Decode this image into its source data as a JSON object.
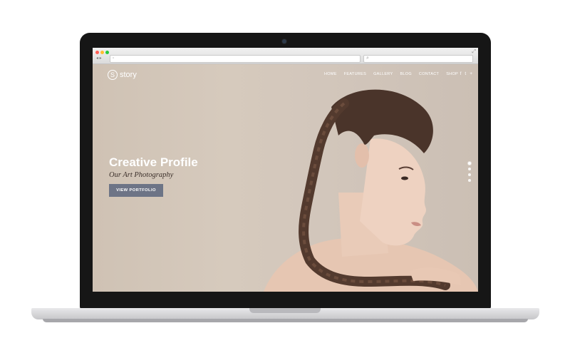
{
  "site": {
    "logo_mark": "S",
    "logo_text": "story",
    "nav": [
      "HOME",
      "FEATURES",
      "GALLERY",
      "BLOG",
      "CONTACT",
      "SHOP"
    ],
    "social_icons": [
      "f",
      "t",
      "+"
    ]
  },
  "hero": {
    "title": "Creative Profile",
    "subtitle": "Our Art Photography",
    "cta_label": "VIEW PORTFOLIO"
  },
  "browser": {
    "back_forward": "◂ ▸"
  },
  "icons": {
    "social": [
      "facebook-icon",
      "twitter-icon",
      "google-plus-icon"
    ]
  },
  "colors": {
    "hero_bg": "#d3c7bb",
    "cta_bg": "#6d7486",
    "laptop_bezel": "#161616"
  }
}
